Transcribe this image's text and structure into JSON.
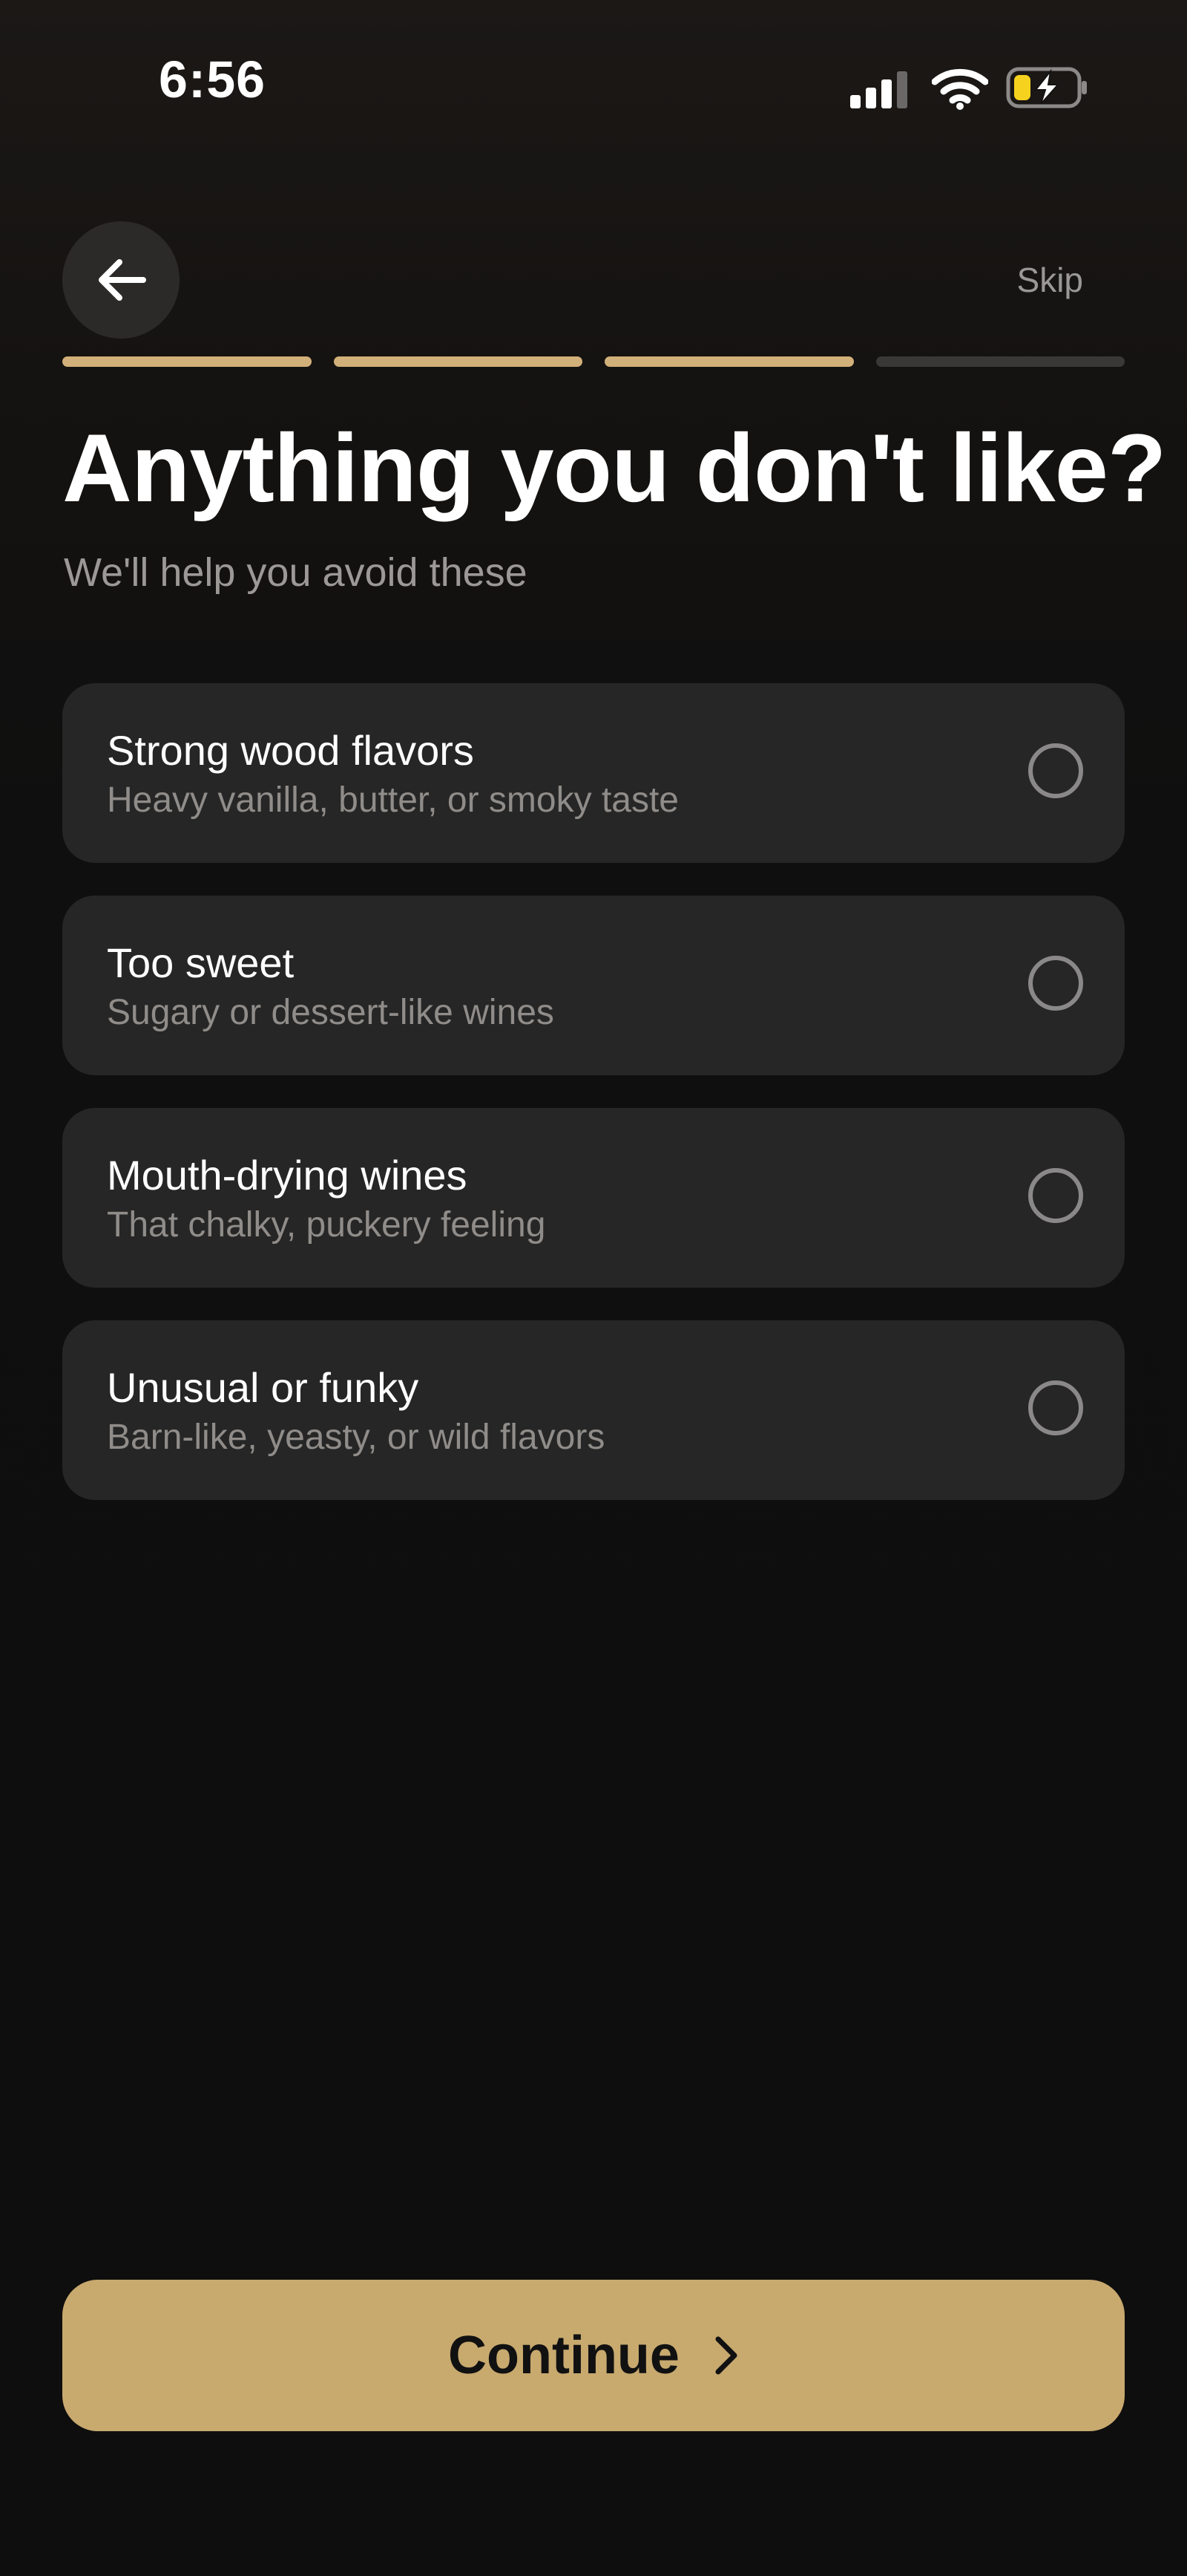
{
  "status_bar": {
    "time": "6:56"
  },
  "header": {
    "skip_label": "Skip"
  },
  "progress": {
    "total_steps": 4,
    "completed_steps": 3
  },
  "title": "Anything you don't like?",
  "subtitle": "We'll help you avoid these",
  "options": [
    {
      "title": "Strong wood flavors",
      "description": "Heavy vanilla, butter, or smoky taste",
      "selected": false
    },
    {
      "title": "Too sweet",
      "description": "Sugary or dessert-like wines",
      "selected": false
    },
    {
      "title": "Mouth-drying wines",
      "description": "That chalky, puckery feeling",
      "selected": false
    },
    {
      "title": "Unusual or funky",
      "description": "Barn-like, yeasty, or wild flavors",
      "selected": false
    }
  ],
  "continue_label": "Continue",
  "colors": {
    "accent": "#c8a96e",
    "progress_done": "#d2b07a",
    "progress_todo": "#3a3836",
    "card_bg": "#262626",
    "battery_fill": "#f5d21e"
  },
  "icons": {
    "back": "arrow-left-icon",
    "continue": "chevron-right-icon",
    "signal": "cellular-signal-icon",
    "wifi": "wifi-icon",
    "battery": "battery-charging-icon"
  }
}
